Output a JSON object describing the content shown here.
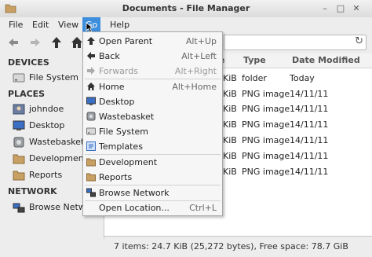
{
  "window": {
    "title": "Documents - File Manager"
  },
  "menubar": {
    "items": [
      "File",
      "Edit",
      "View",
      "Go",
      "Help"
    ]
  },
  "sidebar": {
    "devices_heading": "DEVICES",
    "devices": [
      "File System"
    ],
    "places_heading": "PLACES",
    "places": [
      "johndoe",
      "Desktop",
      "Wastebasket",
      "Development",
      "Reports"
    ],
    "network_heading": "NETWORK",
    "network": [
      "Browse Network"
    ]
  },
  "columns": {
    "size_suffix": "e",
    "type": "Type",
    "date": "Date Modified"
  },
  "rows": [
    {
      "size": "KiB",
      "type": "folder",
      "date": "Today"
    },
    {
      "size": "KiB",
      "type": "PNG image",
      "date": "14/11/11"
    },
    {
      "size": "KiB",
      "type": "PNG image",
      "date": "14/11/11"
    },
    {
      "size": "KiB",
      "type": "PNG image",
      "date": "14/11/11"
    },
    {
      "size": "KiB",
      "type": "PNG image",
      "date": "14/11/11"
    },
    {
      "size": "KiB",
      "type": "PNG image",
      "date": "14/11/11"
    },
    {
      "size": "KiB",
      "type": "PNG image",
      "date": "14/11/11"
    }
  ],
  "status": "7 items: 24.7 KiB (25,272 bytes), Free space: 78.7 GiB",
  "go_menu": {
    "items": [
      {
        "label": "Open Parent",
        "accel": "Alt+Up",
        "icon": "arrow-up-icon"
      },
      {
        "label": "Back",
        "accel": "Alt+Left",
        "icon": "arrow-left-icon"
      },
      {
        "label": "Forwards",
        "accel": "Alt+Right",
        "icon": "arrow-right-icon",
        "disabled": true
      },
      {
        "label": "Home",
        "accel": "Alt+Home",
        "icon": "home-icon"
      },
      {
        "label": "Desktop",
        "accel": "",
        "icon": "desktop-icon"
      },
      {
        "label": "Wastebasket",
        "accel": "",
        "icon": "trash-icon"
      },
      {
        "label": "File System",
        "accel": "",
        "icon": "drive-icon"
      },
      {
        "label": "Templates",
        "accel": "",
        "icon": "templates-icon"
      },
      {
        "label": "Development",
        "accel": "",
        "icon": "folder-icon"
      },
      {
        "label": "Reports",
        "accel": "",
        "icon": "folder-icon"
      },
      {
        "label": "Browse Network",
        "accel": "",
        "icon": "network-icon"
      },
      {
        "label": "Open Location...",
        "accel": "Ctrl+L",
        "icon": ""
      }
    ]
  }
}
